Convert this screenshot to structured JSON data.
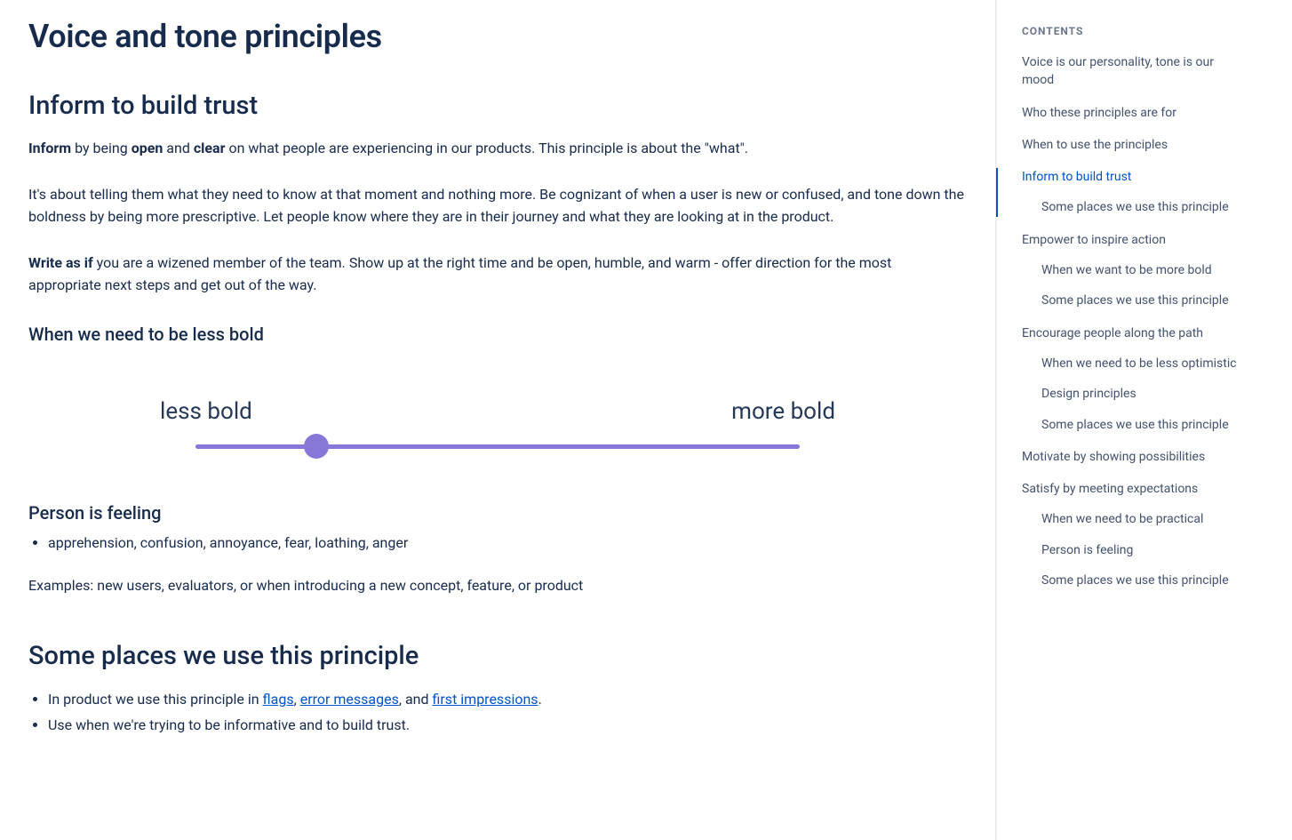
{
  "page": {
    "title": "Voice and tone principles",
    "section_heading": "Inform to build trust",
    "p1_inform": "Inform",
    "p1_mid1": " by being ",
    "p1_open": "open",
    "p1_mid2": " and ",
    "p1_clear": "clear",
    "p1_tail": " on what people are experiencing in our products. This principle is about the \"what\".",
    "p2": "It's about telling them what they need to know at that moment and nothing more. Be cognizant of when a user is new or confused, and tone down the boldness by being more prescriptive. Let people know where they are in their journey and what they are looking at in the product.",
    "p3_lead": "Write as if",
    "p3_tail": " you are a wizened member of the team. Show up at the right time and be open, humble, and warm - offer direction for the most appropriate next steps and get out of the way.",
    "h3_less_bold": "When we need to be less bold",
    "slider": {
      "left": "less bold",
      "right": "more bold"
    },
    "h3_feeling": "Person is feeling",
    "feeling_bullet": "apprehension, confusion, annoyance, fear, loathing, anger",
    "examples_line": "Examples: new users, evaluators, or when introducing a new concept, feature, or product",
    "h2_some_places": "Some places we use this principle",
    "places_b1_pre": "In product we use this principle in ",
    "places_b1_link1": "flags",
    "places_b1_sep1": ", ",
    "places_b1_link2": "error messages",
    "places_b1_sep2": ", and ",
    "places_b1_link3": "first impressions",
    "places_b1_post": ".",
    "places_b2": "Use when we're trying to be informative and to build trust."
  },
  "toc": {
    "heading": "CONTENTS",
    "items": [
      {
        "label": "Voice is our personality, tone is our mood",
        "active": false,
        "sub": []
      },
      {
        "label": "Who these principles are for",
        "active": false,
        "sub": []
      },
      {
        "label": "When to use the principles",
        "active": false,
        "sub": []
      },
      {
        "label": "Inform to build trust",
        "active": true,
        "sub": [
          "Some places we use this principle"
        ]
      },
      {
        "label": "Empower to inspire action",
        "active": false,
        "sub": [
          "When we want to be more bold",
          "Some places we use this principle"
        ]
      },
      {
        "label": "Encourage people along the path",
        "active": false,
        "sub": [
          "When we need to be less optimistic",
          "Design principles",
          "Some places we use this principle"
        ]
      },
      {
        "label": "Motivate by showing possibilities",
        "active": false,
        "sub": []
      },
      {
        "label": "Satisfy by meeting expectations",
        "active": false,
        "sub": [
          "When we need to be practical",
          "Person is feeling",
          "Some places we use this principle"
        ]
      }
    ]
  }
}
